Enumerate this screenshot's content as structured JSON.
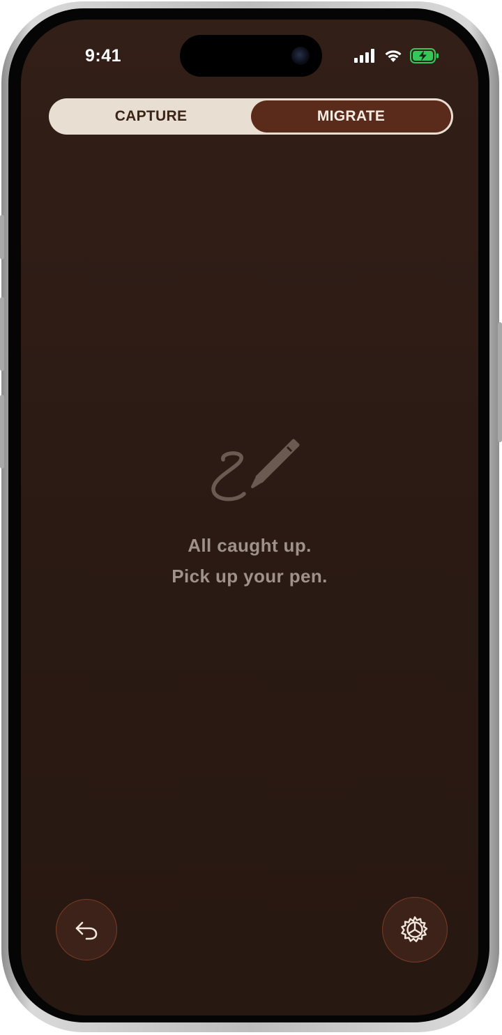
{
  "status_bar": {
    "time": "9:41"
  },
  "mode_switch": {
    "options": [
      "CAPTURE",
      "MIGRATE"
    ],
    "selected": "MIGRATE"
  },
  "empty_state": {
    "icon": "pen-scribble-icon",
    "line1": "All caught up.",
    "line2": "Pick up your pen."
  },
  "actions": {
    "undo_icon": "undo-icon",
    "settings_icon": "gear-icon"
  },
  "colors": {
    "background": "#2b1a14",
    "accent": "#5a2a1a",
    "segment_bg": "#e8dfd2",
    "muted_text": "#9f928a",
    "battery_green": "#34c759"
  }
}
